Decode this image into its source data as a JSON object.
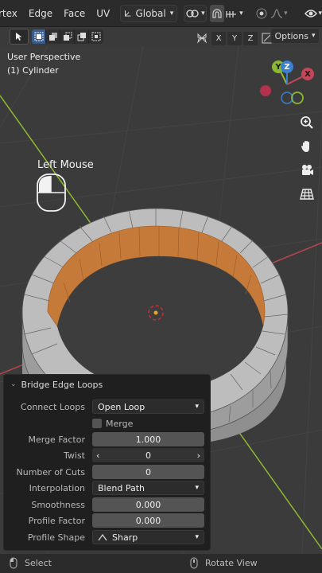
{
  "header": {
    "menu": [
      "rtex",
      "Edge",
      "Face",
      "UV"
    ],
    "orientation": "Global",
    "options_label": "Options",
    "axes": [
      "X",
      "Y",
      "Z"
    ]
  },
  "viewport": {
    "perspective": "User Perspective",
    "object": "(1) Cylinder",
    "mouse_hint": "Left Mouse",
    "gizmo": {
      "y": "Y",
      "z": "Z",
      "x": "X"
    }
  },
  "operator": {
    "title": "Bridge Edge Loops",
    "rows": {
      "connect_loops": {
        "label": "Connect Loops",
        "value": "Open Loop"
      },
      "merge": {
        "label": "Merge"
      },
      "merge_factor": {
        "label": "Merge Factor",
        "value": "1.000"
      },
      "twist": {
        "label": "Twist",
        "value": "0"
      },
      "number_of_cuts": {
        "label": "Number of Cuts",
        "value": "0"
      },
      "interpolation": {
        "label": "Interpolation",
        "value": "Blend Path"
      },
      "smoothness": {
        "label": "Smoothness",
        "value": "0.000"
      },
      "profile_factor": {
        "label": "Profile Factor",
        "value": "0.000"
      },
      "profile_shape": {
        "label": "Profile Shape",
        "value": "Sharp"
      }
    }
  },
  "status": {
    "left": "Select",
    "right": "Rotate View"
  },
  "colors": {
    "selected_face": "#c87a3a",
    "mesh": "#b4b4b4",
    "accent": "#3a5c8c"
  }
}
